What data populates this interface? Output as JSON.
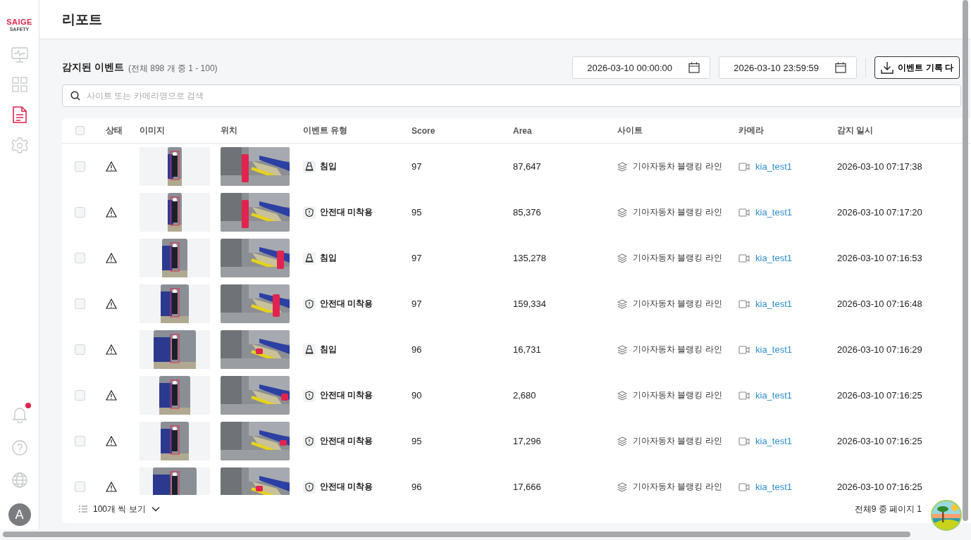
{
  "sidebar": {
    "logo": {
      "brand": "SAIGE",
      "sub": "SAFETY"
    },
    "items": [
      {
        "kind": "monitor",
        "selected": false
      },
      {
        "kind": "grid",
        "selected": false
      },
      {
        "kind": "report",
        "selected": true
      },
      {
        "kind": "settings",
        "selected": false
      }
    ],
    "bottom": {
      "has_notifications": true,
      "avatar": "A"
    }
  },
  "header": {
    "title": "리포트"
  },
  "section": {
    "title": "감지된 이벤트",
    "count": "(전체 898 개 중 1 - 100)"
  },
  "filters": {
    "start": "2026-03-10 00:00:00",
    "end": "2026-03-10 23:59:59",
    "download": "이벤트 기록 다"
  },
  "search": {
    "placeholder": "사이트 또는 카메라명으로 검색"
  },
  "table": {
    "select_all": {
      "checked": false
    },
    "columns": [
      "상태",
      "이미지",
      "위치",
      "이벤트 유형",
      "Score",
      "Area",
      "사이트",
      "카메라",
      "감지 일시"
    ],
    "rows": [
      {
        "checked": false,
        "event": {
          "kind": "intrusion",
          "label": "침입"
        },
        "score": "97",
        "area": "87,647",
        "site": "기아자동차 블랭킹 라인",
        "camera": "kia_test1",
        "time": "2026-03-10 07:17:38"
      },
      {
        "checked": false,
        "event": {
          "kind": "no-belt",
          "label": "안전대 미착용"
        },
        "score": "95",
        "area": "85,376",
        "site": "기아자동차 블랭킹 라인",
        "camera": "kia_test1",
        "time": "2026-03-10 07:17:20"
      },
      {
        "checked": false,
        "event": {
          "kind": "intrusion",
          "label": "침입"
        },
        "score": "97",
        "area": "135,278",
        "site": "기아자동차 블랭킹 라인",
        "camera": "kia_test1",
        "time": "2026-03-10 07:16:53"
      },
      {
        "checked": false,
        "event": {
          "kind": "no-belt",
          "label": "안전대 미착용"
        },
        "score": "97",
        "area": "159,334",
        "site": "기아자동차 블랭킹 라인",
        "camera": "kia_test1",
        "time": "2026-03-10 07:16:48"
      },
      {
        "checked": false,
        "event": {
          "kind": "intrusion",
          "label": "침입"
        },
        "score": "96",
        "area": "16,731",
        "site": "기아자동차 블랭킹 라인",
        "camera": "kia_test1",
        "time": "2026-03-10 07:16:29"
      },
      {
        "checked": false,
        "event": {
          "kind": "no-belt",
          "label": "안전대 미착용"
        },
        "score": "90",
        "area": "2,680",
        "site": "기아자동차 블랭킹 라인",
        "camera": "kia_test1",
        "time": "2026-03-10 07:16:25"
      },
      {
        "checked": false,
        "event": {
          "kind": "no-belt",
          "label": "안전대 미착용"
        },
        "score": "95",
        "area": "17,296",
        "site": "기아자동차 블랭킹 라인",
        "camera": "kia_test1",
        "time": "2026-03-10 07:16:25"
      },
      {
        "checked": false,
        "event": {
          "kind": "no-belt",
          "label": "안전대 미착용"
        },
        "score": "96",
        "area": "17,666",
        "site": "기아자동차 블랭킹 라인",
        "camera": "kia_test1",
        "time": "2026-03-10 07:16:25"
      }
    ]
  },
  "footer": {
    "page_size": "100개 씩 보기",
    "pages": "전체9 중 페이지 1"
  }
}
